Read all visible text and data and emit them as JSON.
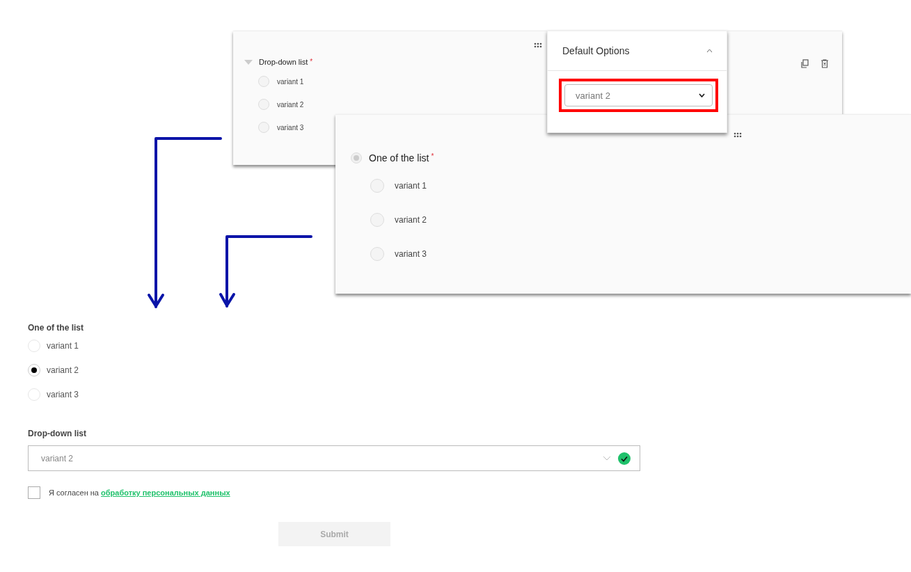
{
  "editor_cards": [
    {
      "kind": "dropdown",
      "title": "Drop-down list",
      "required_mark": "*",
      "options": [
        {
          "label": "variant 1",
          "selected": false
        },
        {
          "label": "variant 2",
          "selected": false
        },
        {
          "label": "variant 3",
          "selected": false
        }
      ]
    },
    {
      "kind": "radio",
      "title": "One of the list",
      "required_mark": "*",
      "options": [
        {
          "label": "variant 1",
          "selected": false
        },
        {
          "label": "variant 2",
          "selected": false
        },
        {
          "label": "variant 3",
          "selected": false
        }
      ]
    }
  ],
  "default_options": {
    "title": "Default Options",
    "value": "variant 2"
  },
  "preview": {
    "radio_group": {
      "label": "One of the list",
      "options": [
        {
          "label": "variant 1",
          "selected": false
        },
        {
          "label": "variant 2",
          "selected": true
        },
        {
          "label": "variant 3",
          "selected": false
        }
      ]
    },
    "dropdown": {
      "label": "Drop-down list",
      "value": "variant 2",
      "valid": true
    },
    "consent": {
      "text": "Я согласен на",
      "link": "обработку персональных данных",
      "checked": false
    },
    "submit": {
      "label": "Submit",
      "disabled": true
    }
  }
}
